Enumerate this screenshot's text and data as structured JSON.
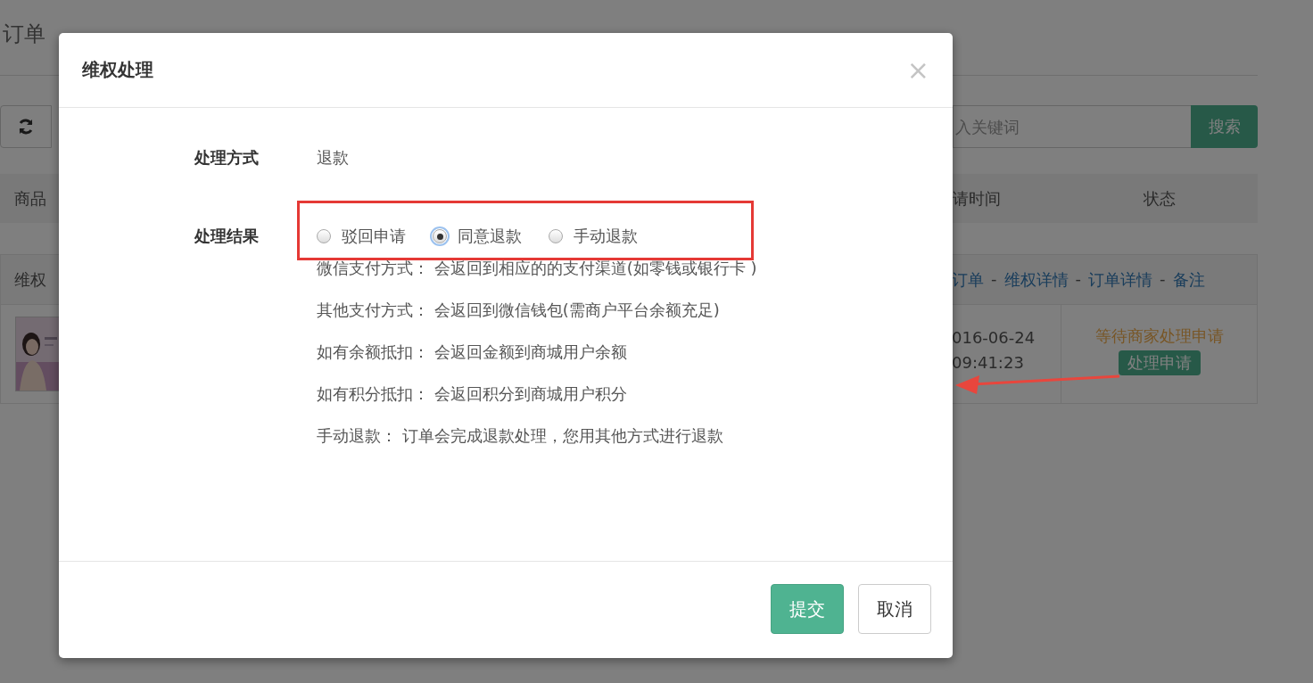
{
  "page": {
    "title": "订单",
    "search_placeholder": "入关键词",
    "search_button": "搜索",
    "columns": [
      "商品",
      "请时间",
      "状态"
    ],
    "group": {
      "label": "维权",
      "links": [
        {
          "kind": "link",
          "text": "订单"
        },
        {
          "kind": "separator",
          "text": "-"
        },
        {
          "kind": "link",
          "text": "维权详情"
        },
        {
          "kind": "separator",
          "text": "-"
        },
        {
          "kind": "link",
          "text": "订单详情"
        },
        {
          "kind": "separator",
          "text": "-"
        },
        {
          "kind": "link",
          "text": "备注"
        }
      ]
    },
    "row": {
      "date": "016-06-24",
      "time": "09:41:23",
      "status": "等待商家处理申请",
      "action": "处理申请"
    }
  },
  "dialog": {
    "title": "维权处理",
    "close": "×",
    "method": {
      "label": "处理方式",
      "value": "退款"
    },
    "result": {
      "label": "处理结果",
      "options": [
        {
          "label": "驳回申请",
          "selected": false
        },
        {
          "label": "同意退款",
          "selected": true
        },
        {
          "label": "手动退款",
          "selected": false
        }
      ]
    },
    "notes": [
      "微信支付方式： 会返回到相应的的支付渠道(如零钱或银行卡 )",
      "其他支付方式： 会返回到微信钱包(需商户平台余额充足)",
      "如有余额抵扣： 会返回金额到商城用户余额",
      "如有积分抵扣： 会返回积分到商城用户积分",
      "手动退款： 订单会完成退款处理，您用其他方式进行退款"
    ],
    "buttons": [
      {
        "label": "提交",
        "kind": "primary"
      },
      {
        "label": "取消",
        "kind": "default"
      }
    ]
  }
}
